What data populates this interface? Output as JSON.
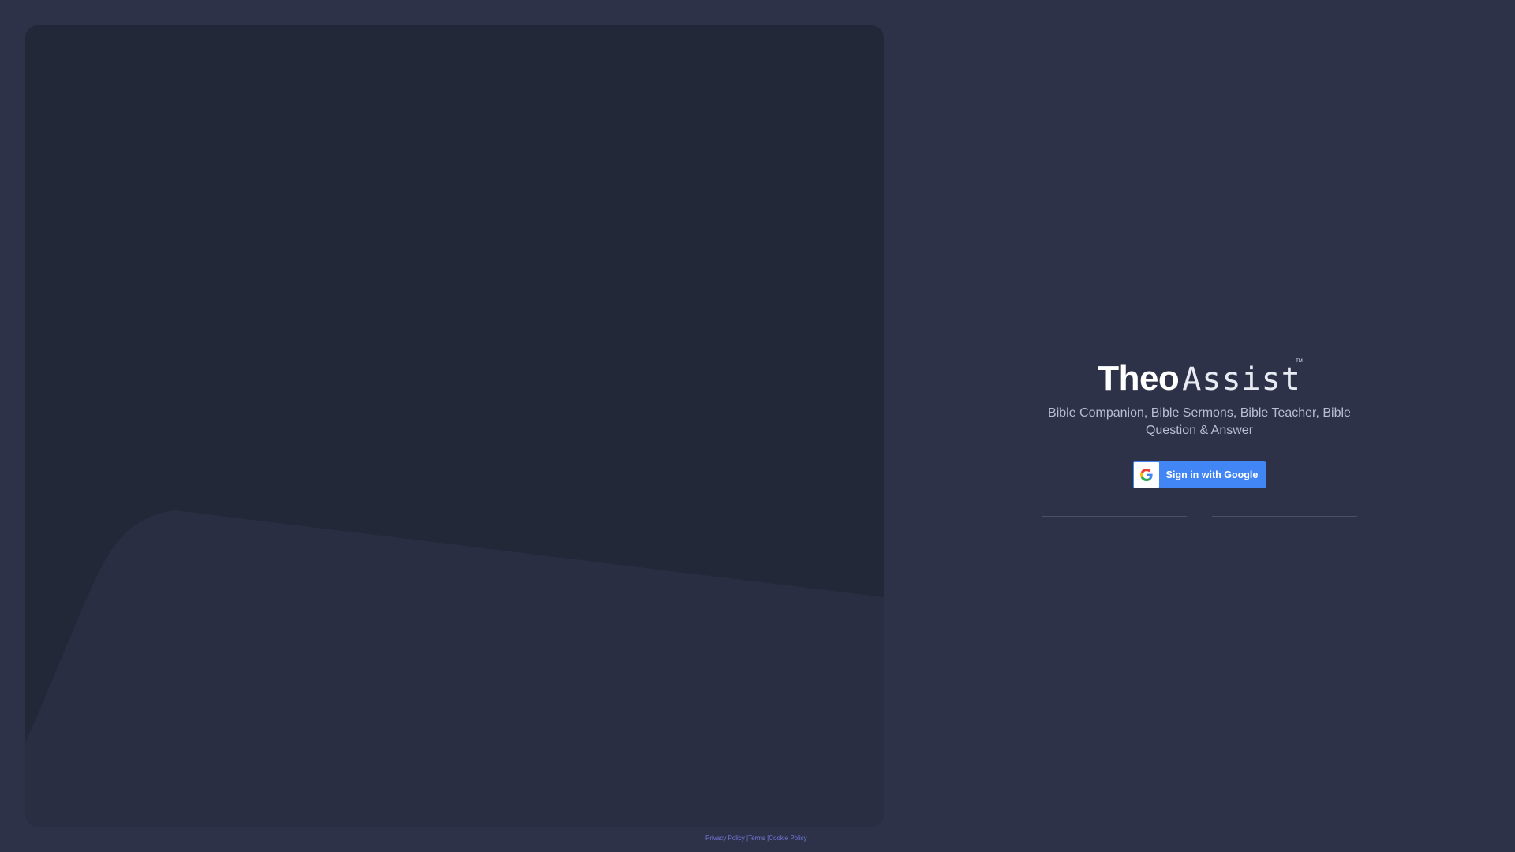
{
  "brand": {
    "name_bold": "Theo",
    "name_light": "Assist",
    "trademark": "TM",
    "tagline": "Bible Companion, Bible Sermons, Bible Teacher, Bible Question & Answer"
  },
  "auth": {
    "google_button_label": "Sign in with Google"
  },
  "footer": {
    "privacy_label": "Privacy Policy",
    "separator1": " |",
    "terms_label": "Terms",
    "separator2": " |",
    "cookie_label": "Cookie Policy"
  },
  "colors": {
    "page_background": "#2e3249",
    "hero_panel": "#232839",
    "hero_wave": "#2a2e43",
    "google_blue": "#4285f4",
    "footer_link": "#6f78d8"
  },
  "icons": {
    "google": "google-g-icon"
  }
}
